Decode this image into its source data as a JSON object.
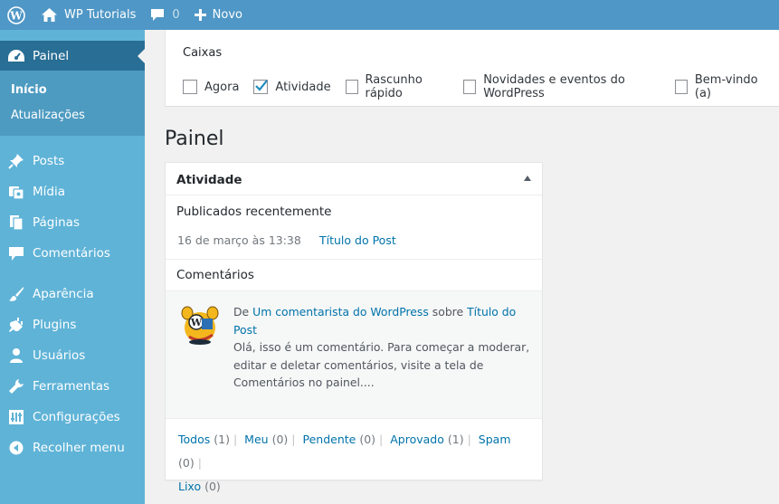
{
  "adminbar": {
    "site_name": "WP Tutorials",
    "comments_count": "0",
    "new_label": "Novo"
  },
  "sidebar": {
    "current": "Painel",
    "submenu": [
      "Início",
      "Atualizações"
    ],
    "items": [
      "Posts",
      "Mídia",
      "Páginas",
      "Comentários",
      "Aparência",
      "Plugins",
      "Usuários",
      "Ferramentas",
      "Configurações",
      "Recolher menu"
    ]
  },
  "screen_options": {
    "title": "Caixas",
    "boxes": [
      {
        "label": "Agora",
        "checked": false
      },
      {
        "label": "Atividade",
        "checked": true
      },
      {
        "label": "Rascunho rápido",
        "checked": false
      },
      {
        "label": "Novidades e eventos do WordPress",
        "checked": false
      },
      {
        "label": "Bem-vindo (a)",
        "checked": false
      }
    ]
  },
  "page_title": "Painel",
  "activity": {
    "title": "Atividade",
    "published_heading": "Publicados recentemente",
    "published_date": "16 de março às 13:38",
    "published_title": "Título do Post",
    "comments_heading": "Comentários",
    "comment": {
      "prefix": "De",
      "author": "Um comentarista do WordPress",
      "on": "sobre",
      "post": "Título do Post",
      "body": "Olá, isso é um comentário. Para começar a moderar, editar e deletar comentários, visite a tela de Comentários no painel...."
    },
    "filters": [
      {
        "label": "Todos",
        "count": "(1)"
      },
      {
        "label": "Meu",
        "count": "(0)"
      },
      {
        "label": "Pendente",
        "count": "(0)"
      },
      {
        "label": "Aprovado",
        "count": "(1)"
      },
      {
        "label": "Spam",
        "count": "(0)"
      },
      {
        "label": "Lixo",
        "count": "(0)"
      }
    ]
  },
  "colors": {
    "adminbar": "#4f97c6",
    "sidebar": "#5fb3d7",
    "sidebar_current": "#296e94",
    "link": "#0073aa"
  }
}
